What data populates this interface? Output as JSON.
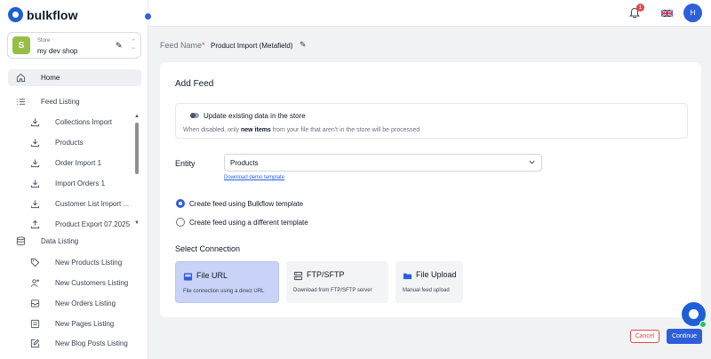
{
  "app": {
    "name": "bulkflow"
  },
  "store": {
    "label": "Store",
    "name": "my dev shop"
  },
  "nav": {
    "home": "Home",
    "feed_listing": {
      "label": "Feed Listing",
      "items": [
        "Collections Import",
        "Products",
        "Order Import 1",
        "Import Orders 1",
        "Customer List Import ...",
        "Product Export 07.2025"
      ]
    },
    "data_listing": {
      "label": "Data Listing",
      "items": [
        "New Products Listing",
        "New Customers Listing",
        "New Orders Listing",
        "New Pages Listing",
        "New Blog Posts Listing"
      ]
    }
  },
  "topbar": {
    "notification_count": "1",
    "avatar_initial": "H",
    "language_icon": "uk-flag-icon"
  },
  "feed": {
    "label": "Feed Name",
    "required_mark": "*",
    "value": "Product Import (Metafield)"
  },
  "form": {
    "title": "Add Feed",
    "update_toggle": {
      "label": "Update existing data in the store",
      "checked": false,
      "desc_before": "When disabled, only ",
      "desc_bold": "new items",
      "desc_after": " from your file that aren't in the store will be processed"
    },
    "entity": {
      "label": "Entity",
      "value": "Products",
      "link": "Download demo template"
    },
    "template_options": [
      {
        "label": "Create feed using Bulkflow template",
        "selected": true
      },
      {
        "label": "Create feed using a different template",
        "selected": false
      }
    ],
    "connection": {
      "title": "Select Connection",
      "options": [
        {
          "label": "File URL",
          "desc": "File connection using a direct URL",
          "icon": "file-url-icon",
          "selected": true
        },
        {
          "label": "FTP/SFTP",
          "desc": "Download from FTP/SFTP server",
          "icon": "ftp-server-icon",
          "selected": false
        },
        {
          "label": "File Upload",
          "desc": "Manual feed upload",
          "icon": "folder-icon",
          "selected": false
        }
      ]
    }
  },
  "buttons": {
    "cancel": "Cancel",
    "continue": "Continue"
  },
  "colors": {
    "primary": "#2f5fd8",
    "danger": "#e24b4b",
    "selected_card": "#c9d3f8"
  }
}
